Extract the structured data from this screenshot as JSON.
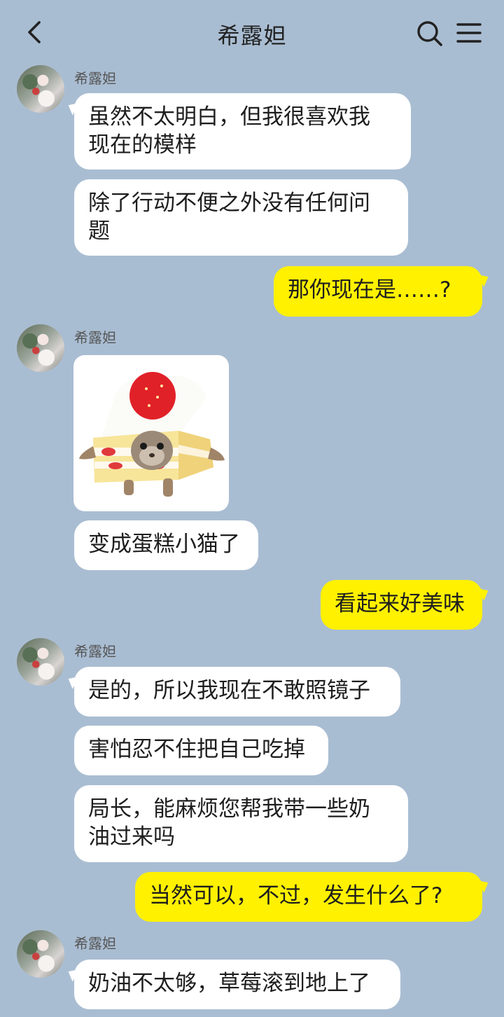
{
  "header": {
    "title": "希露妲"
  },
  "icons": {
    "back": "chevron-left-icon",
    "search": "search-icon",
    "menu": "menu-icon"
  },
  "colors": {
    "background": "#a9bdd2",
    "incoming_bubble": "#ffffff",
    "outgoing_bubble": "#fff100"
  },
  "messages": [
    {
      "side": "in",
      "sender": "希露妲",
      "text": "虽然不太明白，但我很喜欢我\n现在的模样"
    },
    {
      "side": "in",
      "text": "除了行动不便之外没有任何问\n题"
    },
    {
      "side": "out",
      "text": "那你现在是……?"
    },
    {
      "side": "in",
      "sender": "希露妲",
      "type": "sticker",
      "sticker": "cake-cat-sticker"
    },
    {
      "side": "in",
      "text": "变成蛋糕小猫了"
    },
    {
      "side": "out",
      "text": "看起来好美味"
    },
    {
      "side": "in",
      "sender": "希露妲",
      "text": "是的，所以我现在不敢照镜子"
    },
    {
      "side": "in",
      "text": "害怕忍不住把自己吃掉"
    },
    {
      "side": "in",
      "text": "局长，能麻烦您帮我带一些奶\n油过来吗"
    },
    {
      "side": "out",
      "text": "当然可以，不过，发生什么了?"
    },
    {
      "side": "in",
      "sender": "希露妲",
      "text": "奶油不太够，草莓滚到地上了"
    }
  ]
}
